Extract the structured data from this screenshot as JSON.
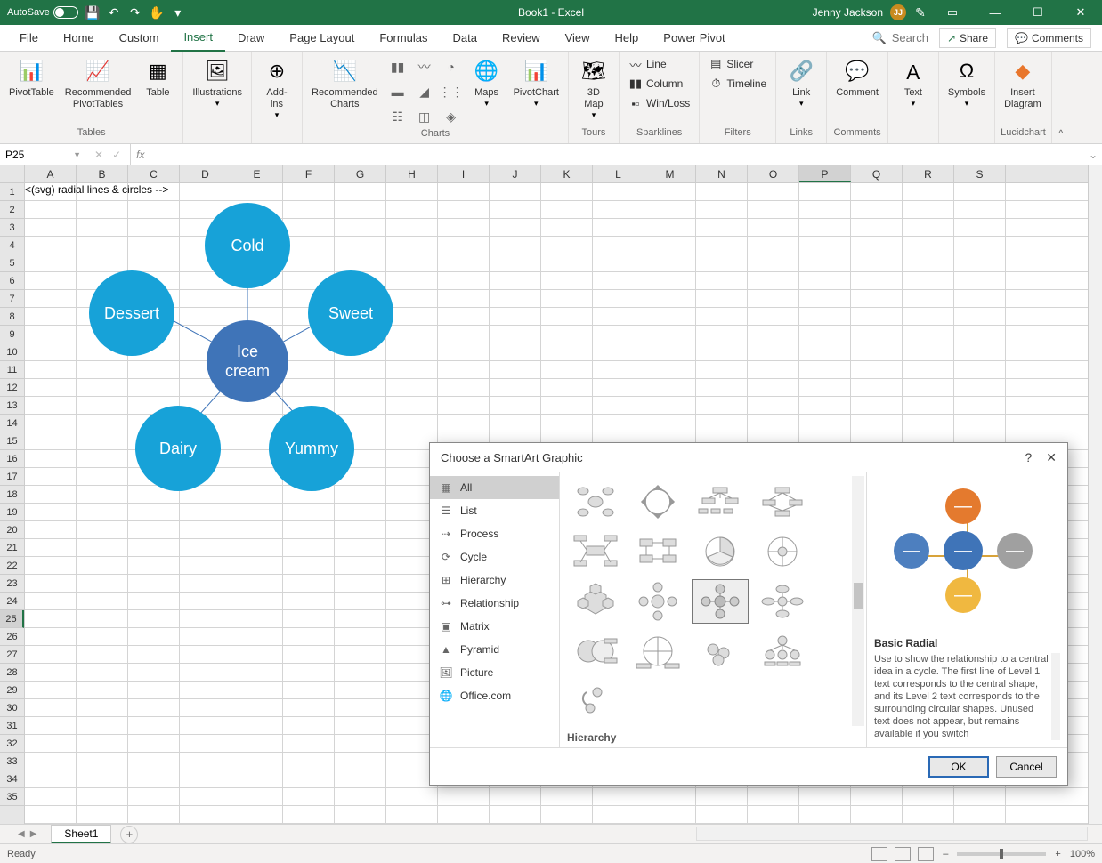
{
  "titlebar": {
    "autosave_label": "AutoSave",
    "autosave_state": "Off",
    "title": "Book1 - Excel",
    "user_name": "Jenny Jackson",
    "user_initials": "JJ"
  },
  "tabs": [
    "File",
    "Home",
    "Custom",
    "Insert",
    "Draw",
    "Page Layout",
    "Formulas",
    "Data",
    "Review",
    "View",
    "Help",
    "Power Pivot"
  ],
  "active_tab": "Insert",
  "search_placeholder": "Search",
  "share_label": "Share",
  "comments_label": "Comments",
  "ribbon": {
    "tables": {
      "label": "Tables",
      "pivottable": "PivotTable",
      "recommended": "Recommended\nPivotTables",
      "table": "Table"
    },
    "illustrations": {
      "label": "",
      "btn": "Illustrations"
    },
    "addins": {
      "label": "",
      "btn": "Add-\nins"
    },
    "charts": {
      "label": "Charts",
      "recommended": "Recommended\nCharts",
      "maps": "Maps",
      "pivotchart": "PivotChart"
    },
    "tours": {
      "label": "Tours",
      "map": "3D\nMap"
    },
    "sparklines": {
      "label": "Sparklines",
      "line": "Line",
      "column": "Column",
      "winloss": "Win/Loss"
    },
    "filters": {
      "label": "Filters",
      "slicer": "Slicer",
      "timeline": "Timeline"
    },
    "links": {
      "label": "Links",
      "link": "Link"
    },
    "comments": {
      "label": "Comments",
      "comment": "Comment"
    },
    "text": {
      "label": "",
      "btn": "Text"
    },
    "symbols": {
      "label": "",
      "btn": "Symbols"
    },
    "lucid": {
      "label": "Lucidchart",
      "btn": "Insert\nDiagram"
    }
  },
  "name_box": "P25",
  "columns": [
    "A",
    "B",
    "C",
    "D",
    "E",
    "F",
    "G",
    "H",
    "I",
    "J",
    "K",
    "L",
    "M",
    "N",
    "O",
    "P",
    "Q",
    "R",
    "S"
  ],
  "row_count": 35,
  "selected_col": "P",
  "selected_row": 25,
  "chart_data": {
    "type": "radial",
    "center": "Ice\ncream",
    "nodes": [
      "Cold",
      "Sweet",
      "Yummy",
      "Dairy",
      "Dessert"
    ]
  },
  "dialog": {
    "title": "Choose a SmartArt Graphic",
    "categories": [
      "All",
      "List",
      "Process",
      "Cycle",
      "Hierarchy",
      "Relationship",
      "Matrix",
      "Pyramid",
      "Picture",
      "Office.com"
    ],
    "selected_category": "All",
    "section_label": "Hierarchy",
    "preview_title": "Basic Radial",
    "preview_desc": "Use to show the relationship to a central idea in a cycle. The first line of Level 1 text corresponds to the central shape, and its Level 2 text corresponds to the surrounding circular shapes. Unused text does not appear, but remains available if you switch",
    "ok": "OK",
    "cancel": "Cancel"
  },
  "sheet_tab": "Sheet1",
  "status": {
    "ready": "Ready",
    "zoom": "100%"
  }
}
